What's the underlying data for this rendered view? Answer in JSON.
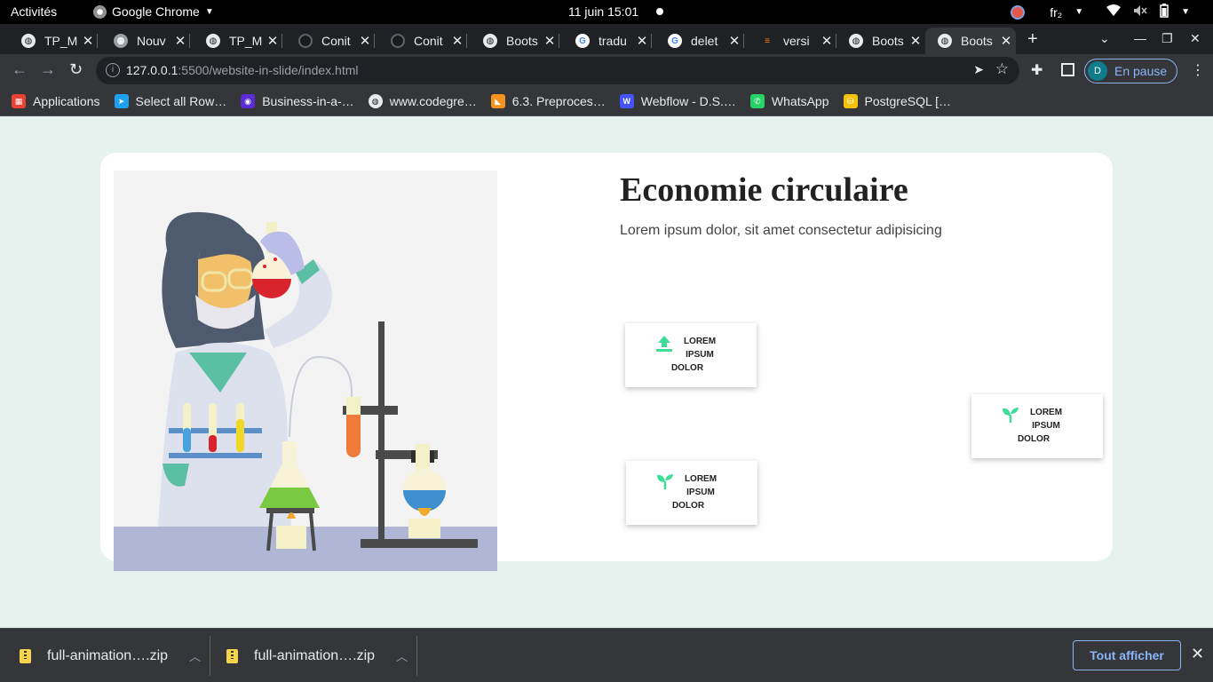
{
  "os_bar": {
    "activities": "Activités",
    "app_name": "Google Chrome",
    "clock": "11 juin  15:01",
    "keyboard": "fr₂"
  },
  "tabs": [
    {
      "title": "TP_M",
      "icon": "globe-icon"
    },
    {
      "title": "Nouv",
      "icon": "chrome-icon"
    },
    {
      "title": "TP_M",
      "icon": "globe-icon"
    },
    {
      "title": "Conit",
      "icon": "github-icon"
    },
    {
      "title": "Conit",
      "icon": "github-icon"
    },
    {
      "title": "Boots",
      "icon": "globe-icon"
    },
    {
      "title": "tradu",
      "icon": "google-icon"
    },
    {
      "title": "delet",
      "icon": "google-icon"
    },
    {
      "title": "versi",
      "icon": "stackoverflow-icon"
    },
    {
      "title": "Boots",
      "icon": "globe-icon"
    },
    {
      "title": "Boots",
      "icon": "globe-icon",
      "active": true
    }
  ],
  "address_bar": {
    "host": "127.0.0.1",
    "path": ":5500/website-in-slide/index.html"
  },
  "profile": {
    "initial": "D",
    "status": "En pause"
  },
  "bookmarks": [
    {
      "label": "Applications",
      "icon": "apps-grid-icon",
      "color": "#ea4335"
    },
    {
      "label": "Select all Row…",
      "icon": "bird-icon",
      "color": "#1da1f2"
    },
    {
      "label": "Business-in-a-…",
      "icon": "circle-logo-icon",
      "color": "#5b2bd6"
    },
    {
      "label": "www.codegre…",
      "icon": "globe-icon",
      "color": "#e8eaed"
    },
    {
      "label": "6.3. Preproces…",
      "icon": "sklearn-icon",
      "color": "#f7931e"
    },
    {
      "label": "Webflow - D.S.…",
      "icon": "webflow-icon",
      "color": "#4353ff"
    },
    {
      "label": "WhatsApp",
      "icon": "whatsapp-icon",
      "color": "#25d366"
    },
    {
      "label": "PostgreSQL […",
      "icon": "database-icon",
      "color": "#f4c20d"
    }
  ],
  "page": {
    "title": "Economie circulaire",
    "subtitle": "Lorem ipsum dolor, sit amet consectetur adipisicing",
    "features": [
      {
        "icon": "upload-icon",
        "line1": "LOREM",
        "line2": "IPSUM",
        "line3": "DOLOR"
      },
      {
        "icon": "sprout-icon",
        "line1": "LOREM",
        "line2": "IPSUM",
        "line3": "DOLOR"
      },
      {
        "icon": "sprout-icon",
        "line1": "LOREM",
        "line2": "IPSUM",
        "line3": "DOLOR"
      }
    ],
    "accent": "#3ddc97"
  },
  "downloads": {
    "items": [
      {
        "name": "full-animation….zip"
      },
      {
        "name": "full-animation….zip"
      }
    ],
    "show_all": "Tout afficher"
  }
}
